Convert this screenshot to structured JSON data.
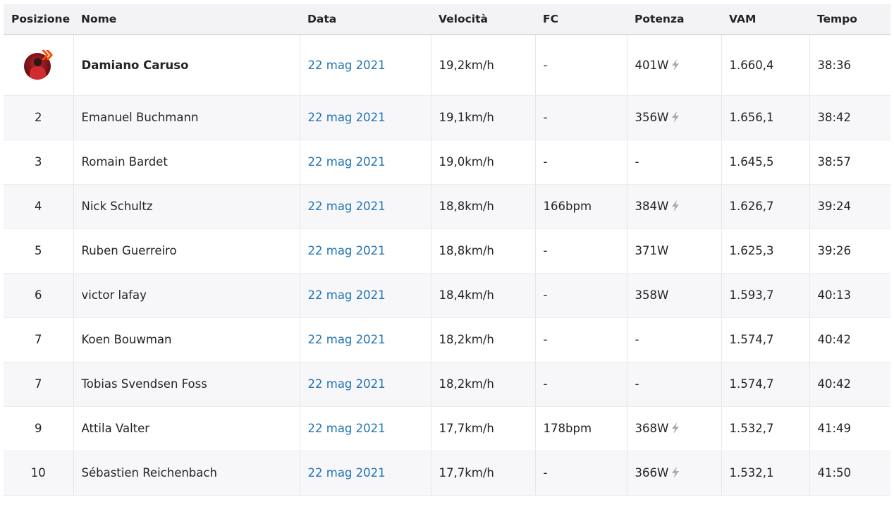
{
  "columns": [
    "Posizione",
    "Nome",
    "Data",
    "Velocità",
    "FC",
    "Potenza",
    "VAM",
    "Tempo"
  ],
  "rows": [
    {
      "pos": "",
      "name": "Damiano Caruso",
      "date": "22 mag 2021",
      "speed": "19,2km/h",
      "hr": "-",
      "power": "401W",
      "power_est": true,
      "vam": "1.660,4",
      "time": "38:36"
    },
    {
      "pos": "2",
      "name": "Emanuel Buchmann",
      "date": "22 mag 2021",
      "speed": "19,1km/h",
      "hr": "-",
      "power": "356W",
      "power_est": true,
      "vam": "1.656,1",
      "time": "38:42"
    },
    {
      "pos": "3",
      "name": "Romain Bardet",
      "date": "22 mag 2021",
      "speed": "19,0km/h",
      "hr": "-",
      "power": "-",
      "power_est": false,
      "vam": "1.645,5",
      "time": "38:57"
    },
    {
      "pos": "4",
      "name": "Nick Schultz",
      "date": "22 mag 2021",
      "speed": "18,8km/h",
      "hr": "166bpm",
      "power": "384W",
      "power_est": true,
      "vam": "1.626,7",
      "time": "39:24"
    },
    {
      "pos": "5",
      "name": "Ruben Guerreiro",
      "date": "22 mag 2021",
      "speed": "18,8km/h",
      "hr": "-",
      "power": "371W",
      "power_est": false,
      "vam": "1.625,3",
      "time": "39:26"
    },
    {
      "pos": "6",
      "name": "victor lafay",
      "date": "22 mag 2021",
      "speed": "18,4km/h",
      "hr": "-",
      "power": "358W",
      "power_est": false,
      "vam": "1.593,7",
      "time": "40:13"
    },
    {
      "pos": "7",
      "name": "Koen Bouwman",
      "date": "22 mag 2021",
      "speed": "18,2km/h",
      "hr": "-",
      "power": "-",
      "power_est": false,
      "vam": "1.574,7",
      "time": "40:42"
    },
    {
      "pos": "7",
      "name": "Tobias Svendsen Foss",
      "date": "22 mag 2021",
      "speed": "18,2km/h",
      "hr": "-",
      "power": "-",
      "power_est": false,
      "vam": "1.574,7",
      "time": "40:42"
    },
    {
      "pos": "9",
      "name": "Attila Valter",
      "date": "22 mag 2021",
      "speed": "17,7km/h",
      "hr": "178bpm",
      "power": "368W",
      "power_est": true,
      "vam": "1.532,7",
      "time": "41:49"
    },
    {
      "pos": "10",
      "name": "Sébastien Reichenbach",
      "date": "22 mag 2021",
      "speed": "17,7km/h",
      "hr": "-",
      "power": "366W",
      "power_est": true,
      "vam": "1.532,1",
      "time": "41:50"
    }
  ],
  "icons": {
    "leader": "leader-avatar-icon",
    "estimated_power": "lightning-bolt-icon"
  },
  "colors": {
    "link": "#1f73b3",
    "header_bg": "#f3f3f5",
    "badge": "#fc4c02"
  }
}
